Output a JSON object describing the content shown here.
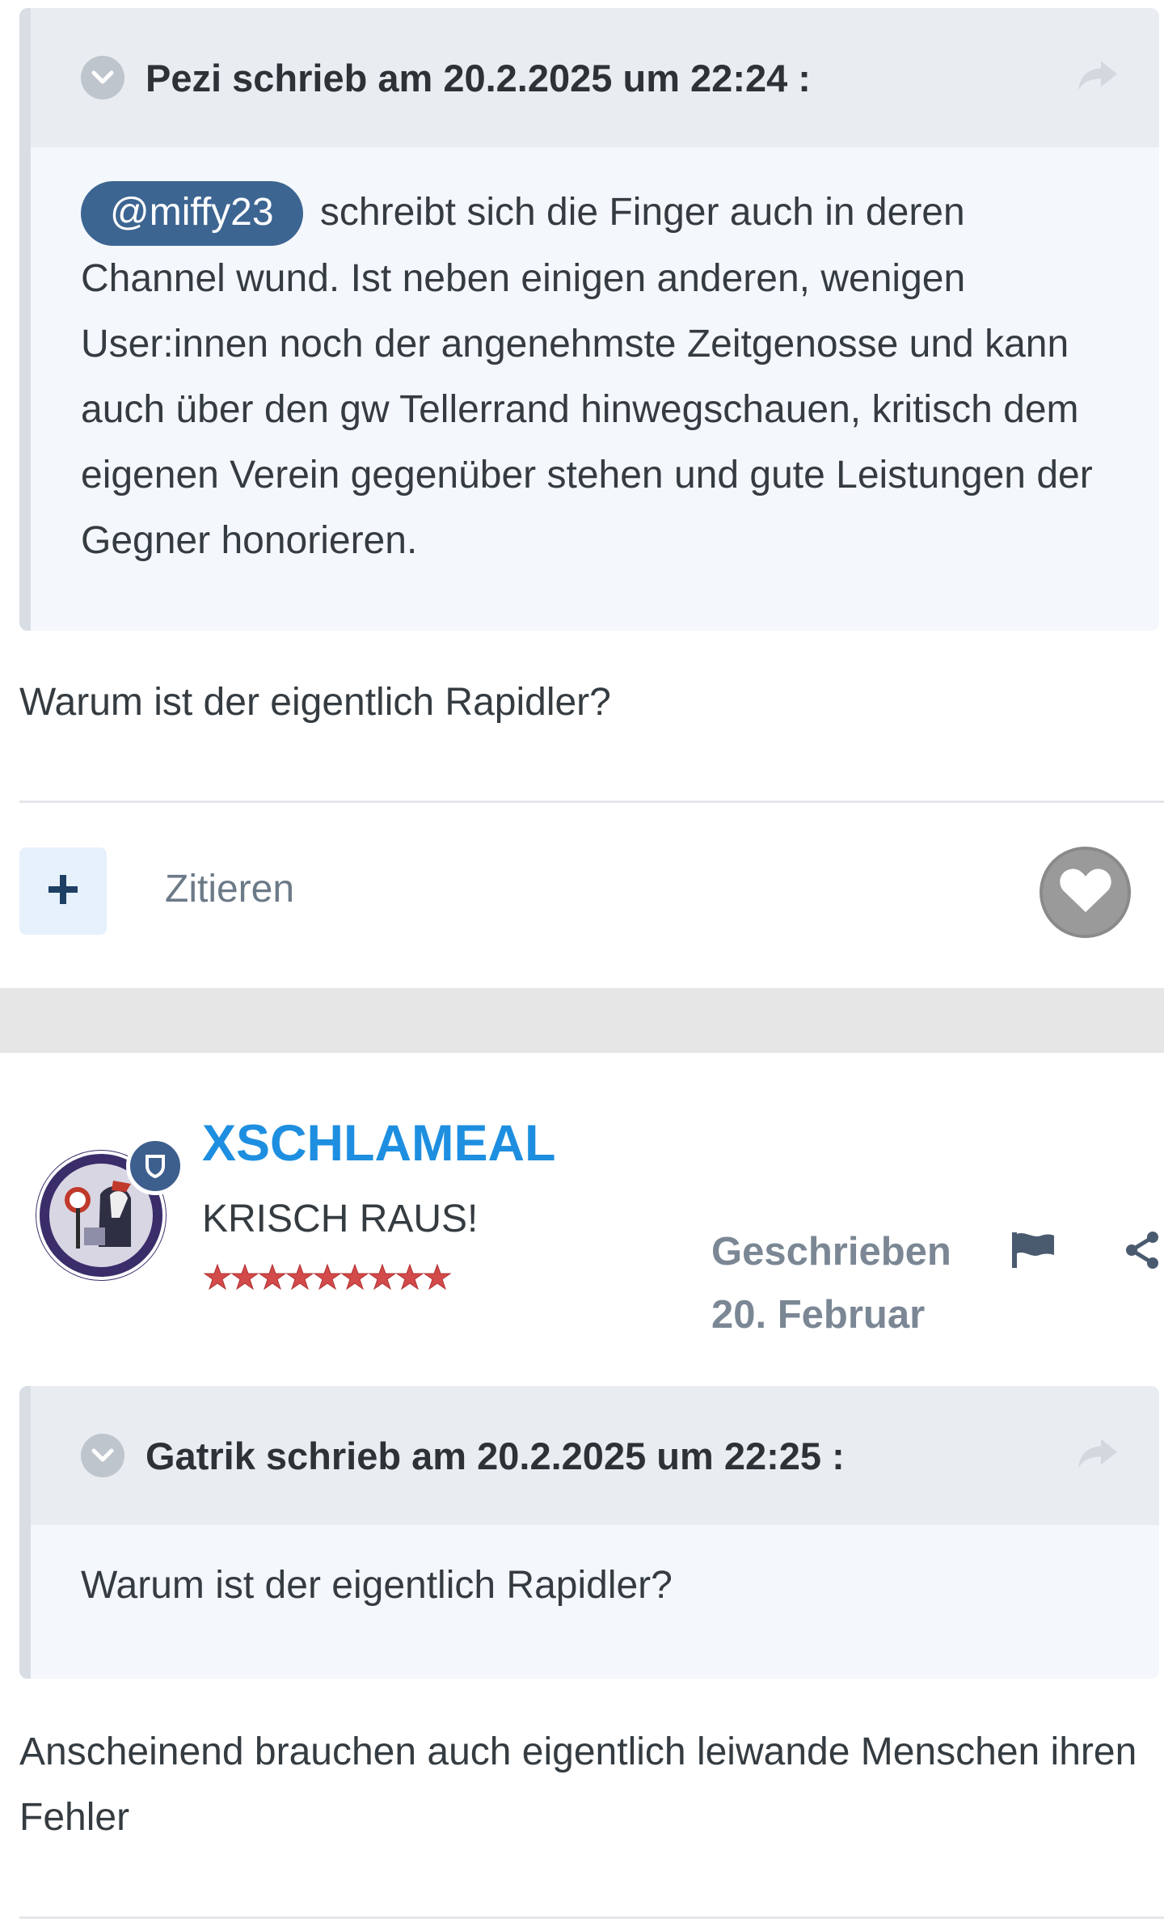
{
  "quote1": {
    "header": "Pezi schrieb am 20.2.2025 um 22:24 :",
    "mention": "@miffy23",
    "text": "schreibt sich die Finger auch in deren Channel wund. Ist neben einigen anderen, wenigen User:innen noch der angenehmste Zeitgenosse und kann auch über den gw Tellerrand hinwegschauen, kritisch dem eigenen Verein gegenüber stehen und gute Leistungen der Gegner honorieren."
  },
  "post1": {
    "text": "Warum ist der eigentlich Rapidler?",
    "quote_label": "Zitieren"
  },
  "post2": {
    "author": {
      "name": "XSCHLAMEAL",
      "title": "KRISCH RAUS!",
      "stars": 9
    },
    "posted_label": "Geschrieben",
    "posted_date": "20. Februar",
    "quote": {
      "header": "Gatrik schrieb am 20.2.2025 um 22:25 :",
      "text": "Warum ist der eigentlich Rapidler?"
    },
    "text": "Anscheinend brauchen auch eigentlich leiwande Menschen ihren Fehler"
  },
  "icons": {
    "expand": "chevron-down-icon",
    "quote_link": "share-arrow-icon",
    "add": "plus-icon",
    "like": "heart-icon",
    "badge": "shield-icon",
    "report": "flag-icon",
    "share": "share-icon"
  },
  "colors": {
    "username": "#1e8fe0",
    "mention_bg": "#3d6592",
    "quote_bg": "#f4f8fc",
    "quote_header_bg": "#e9edf2",
    "star": "#d24a4a"
  }
}
